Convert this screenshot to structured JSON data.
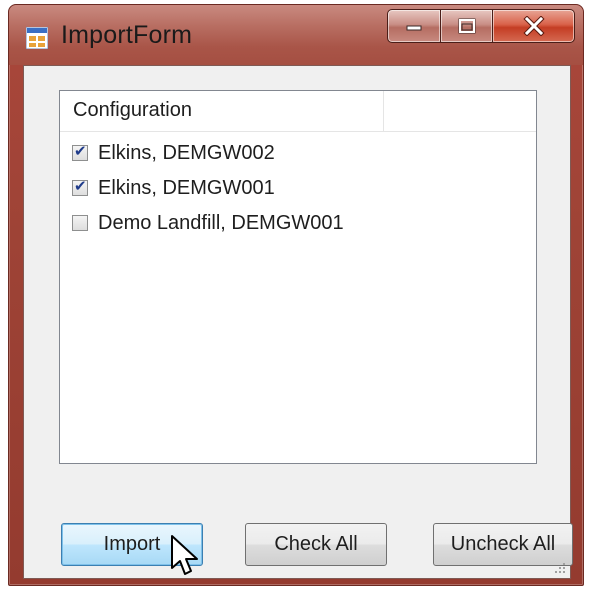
{
  "window": {
    "title": "ImportForm",
    "icon": "winforms-app-icon",
    "controls": {
      "minimize": "minimize-icon",
      "maximize": "maximize-icon",
      "close": "close-icon"
    }
  },
  "list": {
    "columns": [
      "Configuration",
      ""
    ],
    "items": [
      {
        "label": "Elkins, DEMGW002",
        "checked": true
      },
      {
        "label": "Elkins, DEMGW001",
        "checked": true
      },
      {
        "label": "Demo Landfill, DEMGW001",
        "checked": false
      }
    ]
  },
  "buttons": {
    "import": "Import",
    "check_all": "Check All",
    "uncheck_all": "Uncheck All"
  },
  "colors": {
    "frame": "#a54f42",
    "close_button": "#c43d24",
    "check_mark": "#1f3b8a",
    "import_button": "#bee6fd"
  }
}
